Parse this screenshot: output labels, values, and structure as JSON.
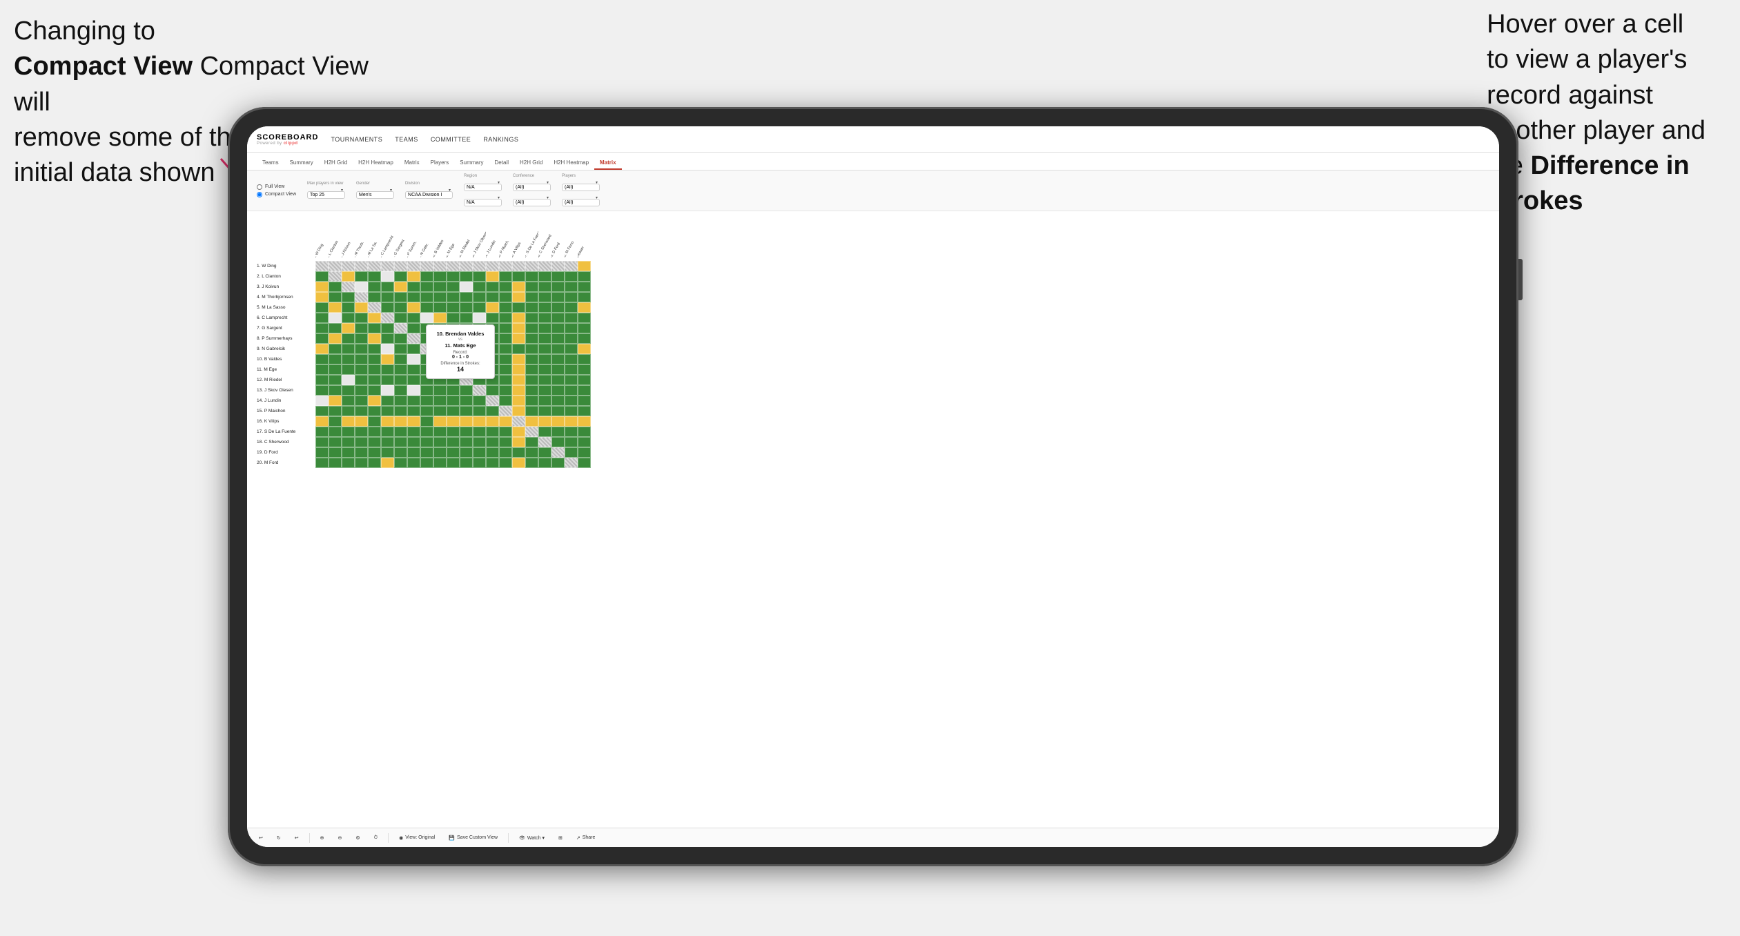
{
  "annotations": {
    "left": {
      "line1": "Changing to",
      "line2": "Compact View will",
      "line3": "remove some of the",
      "line4": "initial data shown"
    },
    "right": {
      "line1": "Hover over a cell",
      "line2": "to view a player's",
      "line3": "record against",
      "line4": "another player and",
      "line5": "the ",
      "bold": "Difference in Strokes"
    }
  },
  "nav": {
    "logo": "SCOREBOARD",
    "logo_sub": "Powered by clippd",
    "items": [
      "TOURNAMENTS",
      "TEAMS",
      "COMMITTEE",
      "RANKINGS"
    ]
  },
  "sub_nav": {
    "items": [
      "Teams",
      "Summary",
      "H2H Grid",
      "H2H Heatmap",
      "Matrix",
      "Players",
      "Summary",
      "Detail",
      "H2H Grid",
      "H2H Heatmap",
      "Matrix"
    ],
    "active": "Matrix"
  },
  "controls": {
    "view_options": [
      "Full View",
      "Compact View"
    ],
    "selected_view": "Compact View",
    "max_players_label": "Max players in view",
    "max_players_value": "Top 25",
    "gender_label": "Gender",
    "gender_value": "Men's",
    "division_label": "Division",
    "division_value": "NCAA Division I",
    "region_label": "Region",
    "region_values": [
      "N/A",
      "N/A"
    ],
    "conference_label": "Conference",
    "conference_values": [
      "(All)",
      "(All)"
    ],
    "players_label": "Players",
    "players_values": [
      "(All)",
      "(All)"
    ]
  },
  "row_names": [
    "1. W Ding",
    "2. L Clanton",
    "3. J Koivun",
    "4. M Thorbjornsen",
    "5. M La Sasso",
    "6. C Lamprecht",
    "7. G Sargent",
    "8. P Summerhays",
    "9. N Gabrelcik",
    "10. B Valdes",
    "11. M Ege",
    "12. M Riedel",
    "13. J Skov Olesen",
    "14. J Lundin",
    "15. P Maichon",
    "16. K Vilips",
    "17. S De La Fuente",
    "18. C Sherwood",
    "19. D Ford",
    "20. M Ford"
  ],
  "col_names": [
    "1. W Ding",
    "2. L Clanton",
    "3. J Koivun",
    "4. M Thorb...",
    "5. M La Sa...",
    "6. C Lamprecht",
    "7. G Sargent",
    "8. P Summ...",
    "9. N Gabre...",
    "10. B Valdes",
    "11. M Ege",
    "12. M Riedel",
    "13. J Skov...",
    "14. J Lundin",
    "15. P Maich...",
    "16. K Vilips",
    "17. S De La...",
    "18. C Sher...",
    "19. D Ford",
    "20. M Ford",
    "Greater"
  ],
  "tooltip": {
    "player1": "10. Brendan Valdes",
    "vs": "vs",
    "player2": "11. Mats Ege",
    "record_label": "Record:",
    "record": "0 - 1 - 0",
    "diff_label": "Difference in Strokes:",
    "diff": "14"
  },
  "toolbar": {
    "undo": "↩",
    "redo": "↪",
    "zoom_in": "+",
    "zoom_out": "-",
    "view_original": "View: Original",
    "save_custom": "Save Custom View",
    "watch": "Watch ▾",
    "share": "Share"
  }
}
